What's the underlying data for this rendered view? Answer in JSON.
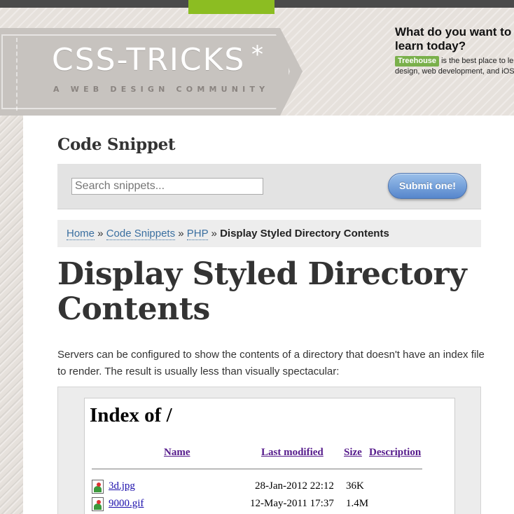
{
  "header": {
    "logo_text": "CSS-TRICKS",
    "logo_star": "*",
    "tagline": "A WEB DESIGN COMMUNITY",
    "accent_color": "#8cbd22"
  },
  "ad": {
    "heading_line1": "What do you want to",
    "heading_line2": "learn today?",
    "badge": "Treehouse",
    "body_line1_rest": " is the best place to le",
    "body_line2": "design, web development, and iOS"
  },
  "snippet_section": {
    "title": "Code Snippet",
    "search_placeholder": "Search snippets...",
    "submit_label": "Submit one!"
  },
  "breadcrumb": {
    "items": [
      "Home",
      "Code Snippets",
      "PHP"
    ],
    "separator": " » ",
    "current": "Display Styled Directory Contents"
  },
  "article": {
    "title": "Display Styled Directory Contents",
    "intro": "Servers can be configured to show the contents of a directory that doesn't have an index file to render. The result is usually less than visually spectacular:"
  },
  "example": {
    "heading": "Index of /",
    "columns": [
      "Name",
      "Last modified",
      "Size",
      "Description"
    ],
    "files": [
      {
        "name": "3d.jpg",
        "modified": "28-Jan-2012 22:12",
        "size": "36K"
      },
      {
        "name": "9000.gif",
        "modified": "12-May-2011 17:37",
        "size": "1.4M"
      }
    ]
  }
}
